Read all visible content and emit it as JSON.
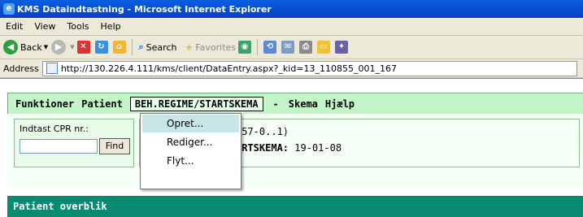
{
  "window": {
    "title": "KMS Dataindtastning - Microsoft Internet Explorer"
  },
  "ie_menu": [
    "Edit",
    "View",
    "Tools",
    "Help"
  ],
  "toolbar": {
    "back_label": "Back",
    "search_label": "Search",
    "favorites_label": "Favorites"
  },
  "address": {
    "label": "Address",
    "url": "http://130.226.4.111/kms/client/DataEntry.aspx?_kid=13_110855_001_167"
  },
  "app_menu": {
    "funktioner": "Funktioner",
    "patient": "Patient",
    "beh_regime": "BEH.REGIME/STARTSKEMA",
    "dash": "-",
    "skema": "Skema",
    "hjaelp": "Hjælp"
  },
  "dropdown": {
    "items": [
      "Opret...",
      "Rediger...",
      "Flyt..."
    ],
    "highlighted_index": 0
  },
  "cpr": {
    "label": "Indtast CPR nr.:",
    "value": "",
    "find_label": "Find"
  },
  "patient": {
    "id_fragment": "657-0..1)",
    "startskema_label": "ARTSKEMA:",
    "startskema_date": "19-01-08"
  },
  "overview": {
    "title": "Patient overblik"
  },
  "colors": {
    "title_bar": "#0a4fd4",
    "app_menu_bg": "#c4f5c9",
    "overview_bar": "#0a8a71",
    "dropdown_highlight": "#c8e6e8"
  }
}
